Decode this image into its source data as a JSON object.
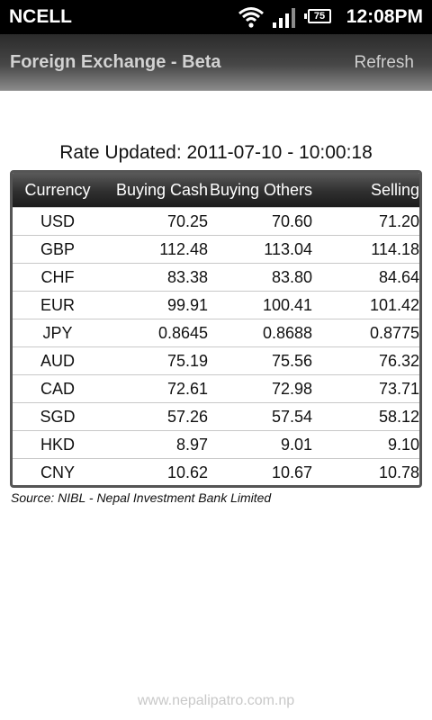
{
  "status_bar": {
    "carrier": "NCELL",
    "battery_level": "75",
    "time": "12:08PM",
    "icons": [
      "wifi-icon",
      "signal-icon",
      "battery-icon"
    ]
  },
  "header": {
    "title": "Foreign Exchange - Beta",
    "refresh_label": "Refresh"
  },
  "rate_updated": "Rate Updated: 2011-07-10 - 10:00:18",
  "table": {
    "columns": [
      "Currency",
      "Buying Cash",
      "Buying Others",
      "Selling"
    ],
    "rows": [
      [
        "USD",
        "70.25",
        "70.60",
        "71.20"
      ],
      [
        "GBP",
        "112.48",
        "113.04",
        "114.18"
      ],
      [
        "CHF",
        "83.38",
        "83.80",
        "84.64"
      ],
      [
        "EUR",
        "99.91",
        "100.41",
        "101.42"
      ],
      [
        "JPY",
        "0.8645",
        "0.8688",
        "0.8775"
      ],
      [
        "AUD",
        "75.19",
        "75.56",
        "76.32"
      ],
      [
        "CAD",
        "72.61",
        "72.98",
        "73.71"
      ],
      [
        "SGD",
        "57.26",
        "57.54",
        "58.12"
      ],
      [
        "HKD",
        "8.97",
        "9.01",
        "9.10"
      ],
      [
        "CNY",
        "10.62",
        "10.67",
        "10.78"
      ]
    ]
  },
  "source": "Source: NIBL - Nepal Investment Bank Limited",
  "footer": "www.nepalipatro.com.np",
  "colors": {
    "header_bg": "#474747",
    "header_text": "#d2d2d2",
    "table_header_bg": "#2f2f2f",
    "footer_text": "#c8c8c8"
  }
}
